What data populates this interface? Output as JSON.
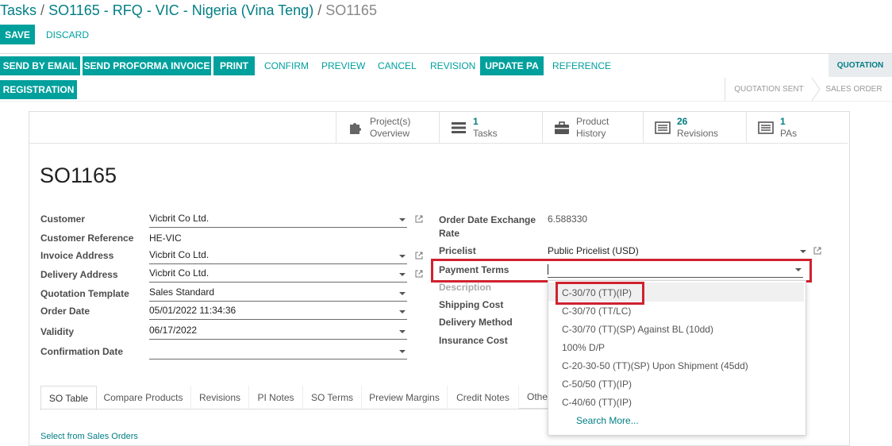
{
  "breadcrumb": {
    "root": "Tasks",
    "sep1": "/",
    "parent": "SO1165 - RFQ - VIC - Nigeria (Vina Teng)",
    "sep2": "/",
    "current": "SO1165"
  },
  "control": {
    "save": "SAVE",
    "discard": "DISCARD"
  },
  "header_buttons": {
    "send_email": "SEND BY EMAIL",
    "send_proforma": "SEND PROFORMA INVOICE",
    "print": "PRINT",
    "confirm": "CONFIRM",
    "preview": "PREVIEW",
    "cancel": "CANCEL",
    "revision": "REVISION",
    "update_pa": "UPDATE PA",
    "reference": "REFERENCE",
    "registration": "REGISTRATION"
  },
  "statusbar": {
    "quotation": "QUOTATION",
    "quotation_sent": "QUOTATION SENT",
    "sales_order": "SALES ORDER"
  },
  "smart_buttons": {
    "projects": {
      "line1": "Project(s)",
      "line2": "Overview",
      "icon": "puzzle-icon"
    },
    "tasks": {
      "num": "1",
      "label": "Tasks",
      "icon": "tasks-icon"
    },
    "product_history": {
      "line1": "Product",
      "line2": "History",
      "icon": "briefcase-icon"
    },
    "revisions": {
      "num": "26",
      "label": "Revisions",
      "icon": "list-icon"
    },
    "pas": {
      "num": "1",
      "label": "PAs",
      "icon": "list-icon"
    }
  },
  "record": {
    "name": "SO1165"
  },
  "left_fields": {
    "customer": {
      "label": "Customer",
      "value": "Vicbrit Co Ltd."
    },
    "customer_ref": {
      "label": "Customer Reference",
      "value": "HE-VIC"
    },
    "invoice_address": {
      "label": "Invoice Address",
      "value": "Vicbrit Co Ltd."
    },
    "delivery_address": {
      "label": "Delivery Address",
      "value": "Vicbrit Co Ltd."
    },
    "quotation_template": {
      "label": "Quotation Template",
      "value": "Sales Standard"
    },
    "order_date": {
      "label": "Order Date",
      "value": "05/01/2022 11:34:36"
    },
    "validity": {
      "label": "Validity",
      "value": "06/17/2022"
    },
    "confirmation_date": {
      "label": "Confirmation Date",
      "value": ""
    }
  },
  "right_fields": {
    "exchange_rate": {
      "label1": "Order Date Exchange",
      "label2": "Rate",
      "value": "6.588330"
    },
    "pricelist": {
      "label": "Pricelist",
      "value": "Public Pricelist (USD)"
    },
    "payment_terms": {
      "label": "Payment Terms",
      "value": ""
    },
    "description": {
      "label": "Description"
    },
    "shipping_cost": {
      "label": "Shipping Cost"
    },
    "delivery_method": {
      "label": "Delivery Method"
    },
    "insurance_cost": {
      "label": "Insurance Cost"
    }
  },
  "dropdown": {
    "options": [
      "C-30/70 (TT)(IP)",
      "C-30/70 (TT/LC)",
      "C-30/70 (TT)(SP) Against BL (10dd)",
      "100% D/P",
      "C-20-30-50 (TT)(SP) Upon Shipment (45dd)",
      "C-50/50 (TT)(IP)",
      "C-40/60 (TT)(IP)"
    ],
    "search_more": "Search More..."
  },
  "tabs": {
    "so_table": "SO Table",
    "compare_products": "Compare Products",
    "revisions": "Revisions",
    "pi_notes": "PI Notes",
    "so_terms": "SO Terms",
    "preview_margins": "Preview Margins",
    "credit_notes": "Credit Notes",
    "other": "Othe"
  },
  "tab_content": {
    "select_from_so": "Select from Sales Orders"
  },
  "colors": {
    "accent": "#00a09d",
    "link": "#017e84",
    "highlight": "#d0212f"
  }
}
